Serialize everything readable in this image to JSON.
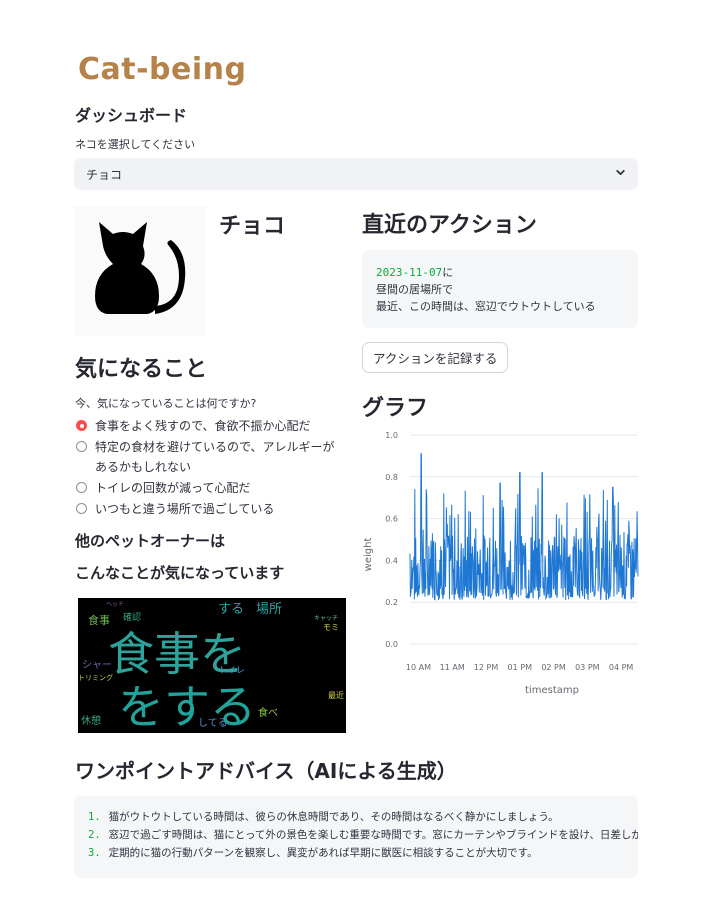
{
  "app": {
    "logo_text": "Cat-being"
  },
  "dashboard": {
    "title": "ダッシュボード",
    "select_label": "ネコを選択してください",
    "selected_cat": "チョコ"
  },
  "profile": {
    "name": "チョコ",
    "image_icon": "cat-silhouette-icon"
  },
  "recent": {
    "title": "直近のアクション",
    "date": "2023-11-07",
    "date_suffix": "に",
    "line2": "昼間の居場所で",
    "line3": "最近、この時間は、窓辺でウトウトしている",
    "record_button": "アクションを記録する"
  },
  "concern": {
    "title": "気になること",
    "question": "今、気になっていることは何ですか?",
    "options": [
      "食事をよく残すので、食欲不振か心配だ",
      "特定の食材を避けているので、アレルギーがあるかもしれない",
      "トイレの回数が減って心配だ",
      "いつもと違う場所で過ごしている"
    ],
    "selected_index": 0
  },
  "others": {
    "title_line1": "他のペットオーナーは",
    "title_line2": "こんなことが気になっています",
    "wordcloud": {
      "big_words": [
        "食事を",
        "をする"
      ],
      "words": [
        "する",
        "場所",
        "食事",
        "シャー",
        "トイレ",
        "休憩",
        "してる",
        "食べ",
        "最近",
        "ヘッド",
        "トリミング",
        "キャッチ",
        "モミ",
        "確認"
      ]
    }
  },
  "graph": {
    "title": "グラフ",
    "chart_data": {
      "type": "line",
      "xlabel": "timestamp",
      "ylabel": "weight",
      "ylim": [
        0,
        1.0
      ],
      "yticks": [
        "0.0",
        "0.2",
        "0.4",
        "0.6",
        "0.8",
        "1.0"
      ],
      "xticks": [
        "10 AM",
        "11 AM",
        "12 PM",
        "01 PM",
        "02 PM",
        "03 PM",
        "04 PM"
      ],
      "series": [
        {
          "color": "#1f77d4",
          "x_range": [
            "09:45",
            "16:30"
          ],
          "y_min": 0.21,
          "y_max": 0.91,
          "baseline": 0.32,
          "peaks": [
            {
              "x": "10:05",
              "y": 0.91
            },
            {
              "x": "10:45",
              "y": 0.72
            },
            {
              "x": "12:25",
              "y": 0.77
            },
            {
              "x": "13:00",
              "y": 0.82
            },
            {
              "x": "13:40",
              "y": 0.82
            },
            {
              "x": "15:45",
              "y": 0.75
            }
          ]
        }
      ]
    }
  },
  "advice": {
    "title": "ワンポイントアドバイス（AIによる生成）",
    "items": [
      "猫がウトウトしている時間は、彼らの休息時間であり、その時間はなるべく静かにしましょう。",
      "窓辺で過ごす時間は、猫にとって外の景色を楽しむ重要な時間です。窓にカーテンやブラインドを設け、日差しが強",
      "定期的に猫の行動パターンを観察し、異変があれば早期に獣医に相談することが大切です。"
    ],
    "numbers": [
      "1.",
      "2.",
      "3."
    ]
  }
}
